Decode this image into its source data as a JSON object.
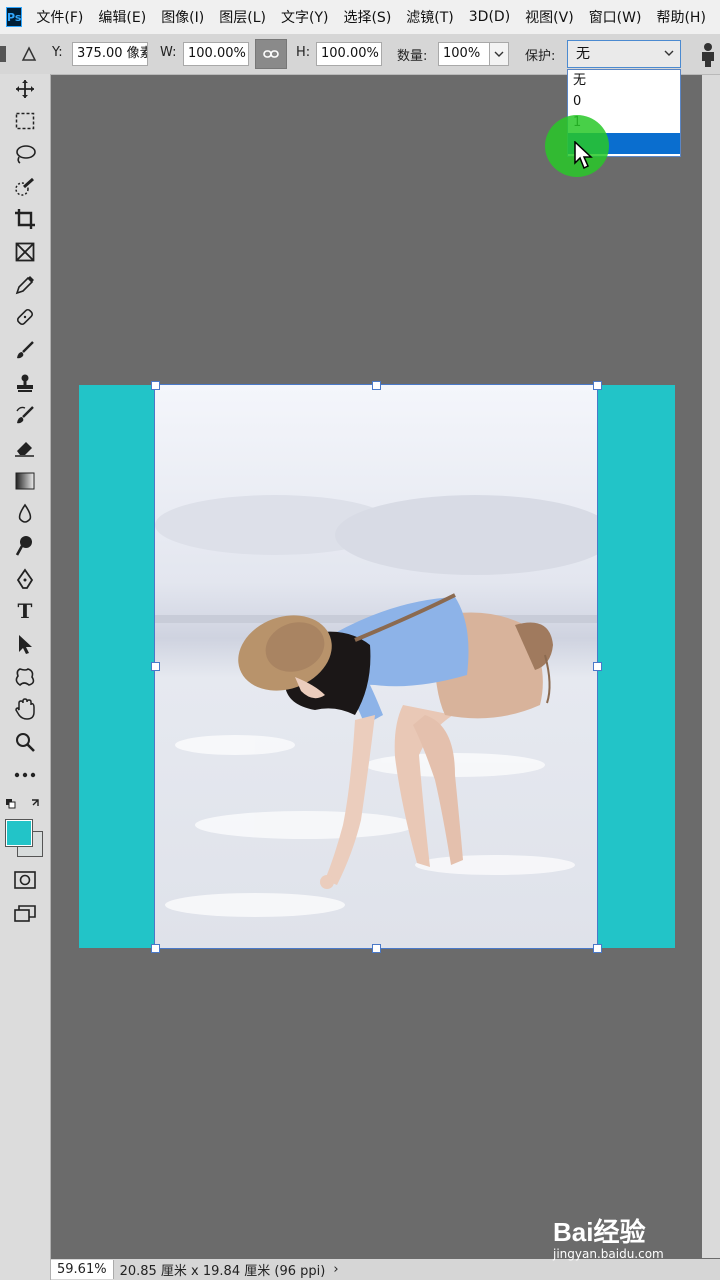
{
  "app": {
    "logo": "Ps"
  },
  "menu": [
    "文件(F)",
    "编辑(E)",
    "图像(I)",
    "图层(L)",
    "文字(Y)",
    "选择(S)",
    "滤镜(T)",
    "3D(D)",
    "视图(V)",
    "窗口(W)",
    "帮助(H)"
  ],
  "options": {
    "y_label": "Y:",
    "y_value": "375.00 像素",
    "w_label": "W:",
    "w_value": "100.00%",
    "h_label": "H:",
    "h_value": "100.00%",
    "amount_label": "数量:",
    "amount_value": "100%",
    "protect_label": "保护:",
    "protect_value": "无"
  },
  "protect_dropdown": {
    "options": [
      "无",
      "0",
      "1",
      "2"
    ],
    "highlighted_index": 3
  },
  "colors": {
    "foreground": "#22c4c8",
    "background": "#d8dcdc",
    "canvas_fill": "#22c4c8",
    "highlight": "#0a6ecf"
  },
  "status": {
    "zoom": "59.61%",
    "doc_info": "20.85 厘米 x 19.84 厘米 (96 ppi)",
    "arrow": "›"
  },
  "watermark": {
    "logo": "Bai经验",
    "url": "jingyan.baidu.com"
  },
  "tools": [
    "move-tool-icon",
    "marquee-tool-icon",
    "lasso-tool-icon",
    "quick-select-tool-icon",
    "crop-tool-icon",
    "frame-tool-icon",
    "eyedropper-tool-icon",
    "healing-brush-tool-icon",
    "brush-tool-icon",
    "clone-stamp-tool-icon",
    "history-brush-tool-icon",
    "eraser-tool-icon",
    "gradient-tool-icon",
    "blur-tool-icon",
    "dodge-tool-icon",
    "pen-tool-icon",
    "type-tool-icon",
    "path-select-tool-icon",
    "custom-shape-tool-icon",
    "hand-tool-icon",
    "zoom-tool-icon",
    "more-tools-icon"
  ]
}
